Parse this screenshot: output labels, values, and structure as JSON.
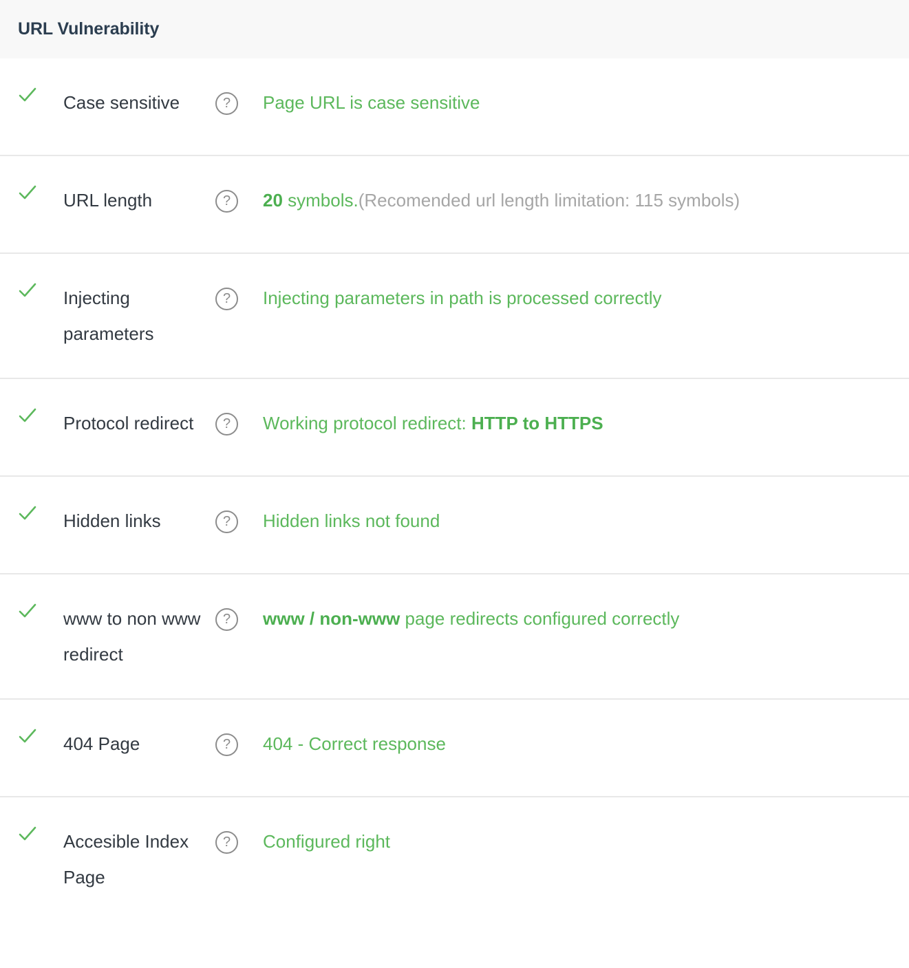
{
  "header": {
    "title": "URL Vulnerability"
  },
  "colors": {
    "pass_green": "#5cb85c",
    "pass_green_bold": "#4caf50",
    "muted_gray": "#a6a6a6",
    "label_dark": "#333a42",
    "title_dark": "#2c3e50",
    "header_bg": "#f8f8f8",
    "divider": "#e8e8e8",
    "help_icon_gray": "#8c8c8c"
  },
  "icons": {
    "status_pass": "check-icon",
    "help": "question-mark-icon",
    "help_glyph": "?"
  },
  "rows": [
    {
      "status": "pass",
      "label": "Case sensitive",
      "result": {
        "parts": [
          {
            "text": "Page URL is case sensitive",
            "style": "normal"
          }
        ]
      }
    },
    {
      "status": "pass",
      "label": "URL length",
      "result": {
        "parts": [
          {
            "text": "20",
            "style": "bold"
          },
          {
            "text": " symbols.",
            "style": "normal"
          },
          {
            "text": "(Recomended url length limitation: 115 symbols)",
            "style": "muted"
          }
        ]
      }
    },
    {
      "status": "pass",
      "label": "Injecting parameters",
      "result": {
        "parts": [
          {
            "text": "Injecting parameters in path is processed correctly",
            "style": "normal"
          }
        ]
      }
    },
    {
      "status": "pass",
      "label": "Protocol redirect",
      "result": {
        "parts": [
          {
            "text": "Working protocol redirect: ",
            "style": "normal"
          },
          {
            "text": "HTTP to HTTPS",
            "style": "bold"
          }
        ]
      }
    },
    {
      "status": "pass",
      "label": "Hidden links",
      "result": {
        "parts": [
          {
            "text": "Hidden links not found",
            "style": "normal"
          }
        ]
      }
    },
    {
      "status": "pass",
      "label": "www to non www redirect",
      "result": {
        "parts": [
          {
            "text": "www / non-www",
            "style": "bold"
          },
          {
            "text": " page redirects configured correctly",
            "style": "normal"
          }
        ]
      }
    },
    {
      "status": "pass",
      "label": "404 Page",
      "result": {
        "parts": [
          {
            "text": "404 - Correct response",
            "style": "normal"
          }
        ]
      }
    },
    {
      "status": "pass",
      "label": "Accesible Index Page",
      "result": {
        "parts": [
          {
            "text": "Configured right",
            "style": "normal"
          }
        ]
      }
    }
  ]
}
